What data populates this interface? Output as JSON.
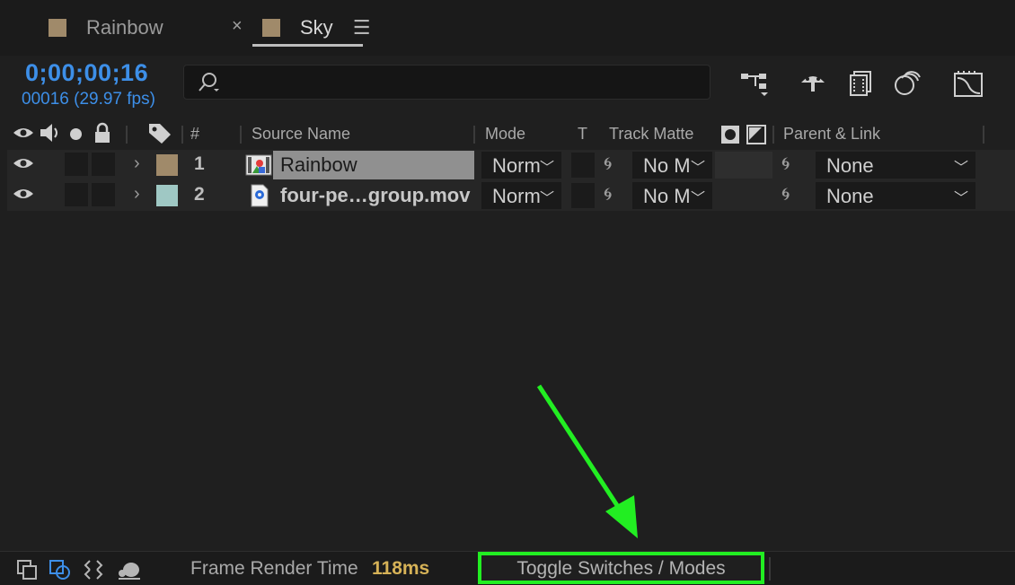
{
  "tabs": [
    {
      "label": "Rainbow",
      "color": "#a08a6a",
      "active": false
    },
    {
      "label": "Sky",
      "color": "#a08a6a",
      "active": true
    }
  ],
  "tab_close_glyph": "×",
  "tab_menu_glyph": "☰",
  "timecode": "0;00;00;16",
  "frame_info": "00016 (29.97 fps)",
  "search": {
    "placeholder": "",
    "value": ""
  },
  "columns": {
    "number": "#",
    "source_name": "Source Name",
    "mode": "Mode",
    "t": "T",
    "track_matte": "Track Matte",
    "parent_link": "Parent & Link"
  },
  "layers": [
    {
      "index": "1",
      "name": "Rainbow",
      "label_color": "#a08a6a",
      "mode": "Norm",
      "track_matte": "No M",
      "parent": "None",
      "selected": true,
      "source_icon": "composition-icon"
    },
    {
      "index": "2",
      "name": "four-pe…group.mov",
      "label_color": "#9fc8c4",
      "mode": "Norm",
      "track_matte": "No M",
      "parent": "None",
      "selected": false,
      "source_icon": "footage-file-icon"
    }
  ],
  "footer": {
    "frame_render_label": "Frame Render Time",
    "frame_render_value": "118ms",
    "toggle_label": "Toggle Switches / Modes"
  },
  "colors": {
    "accent_blue": "#3d8fe8",
    "render_time": "#d6b257",
    "highlight_green": "#22ee22"
  }
}
